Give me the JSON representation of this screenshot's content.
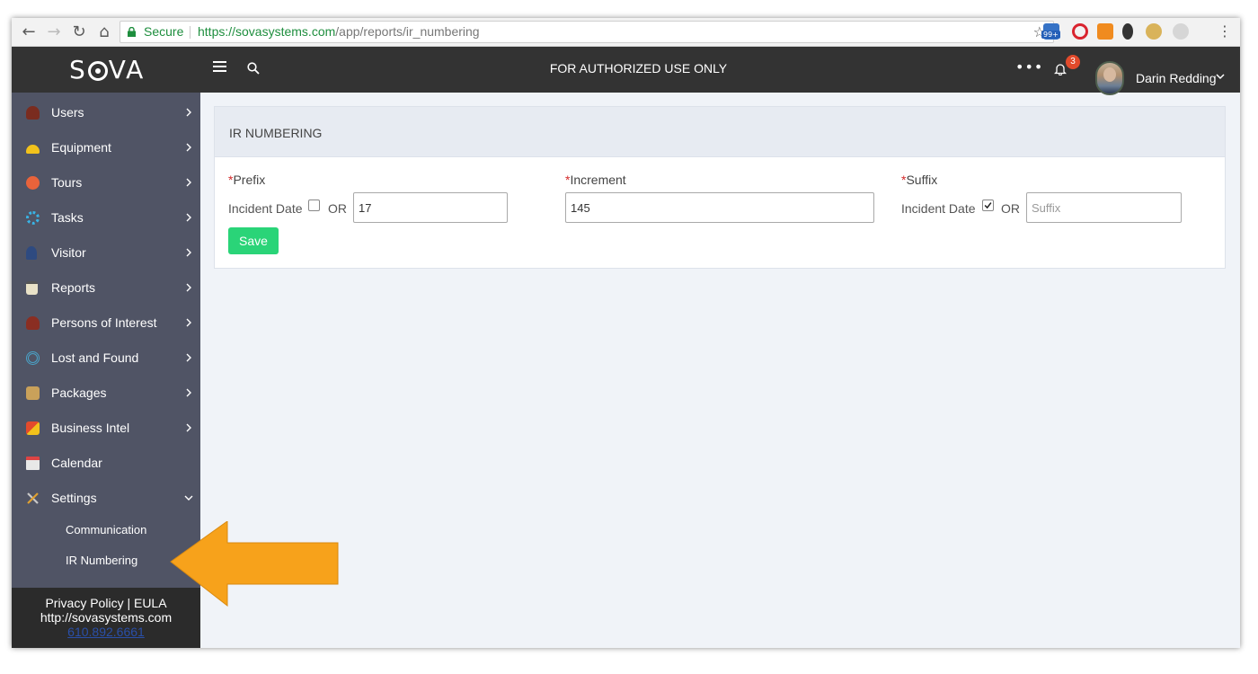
{
  "browser": {
    "secure_label": "Secure",
    "url_host": "https://sovasystems.com",
    "url_path": "/app/reports/ir_numbering",
    "extension_badge": "99+"
  },
  "header": {
    "logo": "SOVA",
    "title": "FOR AUTHORIZED USE ONLY",
    "notification_count": "3",
    "user_name": "Darin Redding"
  },
  "sidebar": {
    "items": [
      {
        "label": "Users",
        "icon": "user-icon",
        "color": "#7a2c1f"
      },
      {
        "label": "Equipment",
        "icon": "hard-hat-icon",
        "color": "#f2c21b"
      },
      {
        "label": "Tours",
        "icon": "compass-icon",
        "color": "#e8633b"
      },
      {
        "label": "Tasks",
        "icon": "tasks-icon",
        "color": "#39b4e6"
      },
      {
        "label": "Visitor",
        "icon": "visitor-icon",
        "color": "#2e4a80"
      },
      {
        "label": "Reports",
        "icon": "clipboard-icon",
        "color": "#e9e2c8"
      },
      {
        "label": "Persons of Interest",
        "icon": "person-icon",
        "color": "#8a2e22"
      },
      {
        "label": "Lost and Found",
        "icon": "target-icon",
        "color": "#4aa3c8"
      },
      {
        "label": "Packages",
        "icon": "package-icon",
        "color": "#c9a15a"
      },
      {
        "label": "Business Intel",
        "icon": "cube-icon",
        "color": "#e34b2c"
      },
      {
        "label": "Calendar",
        "icon": "calendar-icon",
        "color": "#e8e8e8"
      },
      {
        "label": "Settings",
        "icon": "tools-icon",
        "color": "#c8c8c8"
      }
    ],
    "sub_items": [
      "Communication",
      "IR Numbering"
    ],
    "footer": {
      "links": "Privacy Policy | EULA",
      "site": "http://sovasystems.com",
      "phone": "610.892.6661"
    }
  },
  "panel": {
    "title": "IR NUMBERING",
    "prefix": {
      "required_mark": "*",
      "label": "Prefix",
      "option_label": "Incident Date",
      "checked": false,
      "or_label": "OR",
      "value": "17",
      "placeholder": ""
    },
    "increment": {
      "required_mark": "*",
      "label": "Increment",
      "value": "145"
    },
    "suffix": {
      "required_mark": "*",
      "label": "Suffix",
      "option_label": "Incident Date",
      "checked": true,
      "or_label": "OR",
      "value": "",
      "placeholder": "Suffix"
    },
    "save_label": "Save"
  },
  "colors": {
    "header_bg": "#333333",
    "sidebar_bg": "#505465",
    "save_button": "#2ad478",
    "arrow": "#f7a21b"
  }
}
